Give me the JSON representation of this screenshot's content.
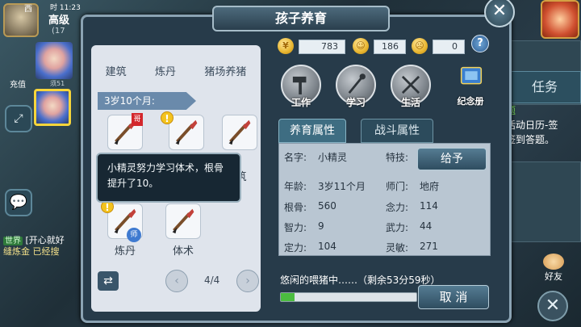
{
  "hud": {
    "label_left": "西",
    "time_label": "时",
    "clock": "11:23",
    "player_name": "高级",
    "player_sub": "(17"
  },
  "sidebar": {
    "recharge_label": "充值",
    "small_label": "须51"
  },
  "chat": {
    "channel": "世界",
    "line1": "[开心就好",
    "line2": "缝炼金    已经搜"
  },
  "right": {
    "task_label": "任务",
    "quest_line1": "题",
    "quest_line2": "活动日历-签",
    "quest_line3": "签到答题。",
    "friend_label": "好友",
    "bottom_close": "✕"
  },
  "panel": {
    "title": "孩子养育",
    "close": "✕",
    "categories": [
      "建筑",
      "炼丹",
      "猪场养猪"
    ],
    "age_banner": "3岁10个月:",
    "slots": [
      {
        "label": "",
        "tag": "哥"
      },
      {
        "label": "",
        "tag": ""
      },
      {
        "label": "筑",
        "tag": ""
      },
      {
        "label": "炼丹",
        "tag": "师"
      },
      {
        "label": "体术",
        "tag": ""
      }
    ],
    "tooltip": "小精灵努力学习体术，根骨提升了10。",
    "page": "4/4",
    "swap": "⇄",
    "prev": "‹",
    "next": "›"
  },
  "currency": {
    "coin1": "783",
    "coin2": "186",
    "coin3": "0",
    "help": "?"
  },
  "actions": {
    "work": "工作",
    "study": "学习",
    "life": "生活",
    "album": "纪念册"
  },
  "tabs": {
    "raise": "养育属性",
    "battle": "战斗属性"
  },
  "attributes": {
    "name_label": "名字:",
    "name_value": "小精灵",
    "skill_label": "特技:",
    "give_button": "给予",
    "age_label": "年龄:",
    "age_value": "3岁11个月",
    "school_label": "师门:",
    "school_value": "地府",
    "bone_label": "根骨:",
    "bone_value": "560",
    "mind_label": "念力:",
    "mind_value": "114",
    "int_label": "智力:",
    "int_value": "9",
    "force_label": "武力:",
    "force_value": "44",
    "focus_label": "定力:",
    "focus_value": "104",
    "agility_label": "灵敏:",
    "agility_value": "271"
  },
  "status": {
    "text": "悠闲的喂猪中……（剩余53分59秒）",
    "progress": 0.1,
    "cancel": "取 消"
  },
  "colors": {
    "panel_bg": "#273b4a",
    "accent_green": "#4bbd40",
    "accent_gold": "#f7d53b"
  }
}
